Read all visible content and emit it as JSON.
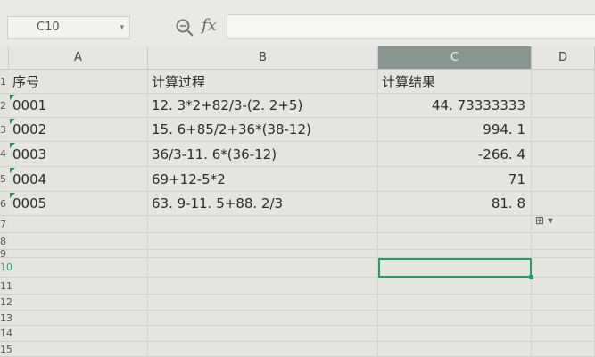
{
  "formula_bar": {
    "name_box": "C10",
    "name_box_caret": "▾",
    "fx_label": "fx",
    "formula_value": ""
  },
  "columns": [
    "A",
    "B",
    "C",
    "D"
  ],
  "rows": [
    "1",
    "2",
    "3",
    "4",
    "5",
    "6",
    "7",
    "8",
    "9",
    "10",
    "11",
    "12",
    "13",
    "14",
    "15"
  ],
  "table": {
    "header": [
      "序号",
      "计算过程",
      "计算结果"
    ],
    "records": [
      {
        "id": "0001",
        "expr": "12. 3*2+82/3-(2. 2+5)",
        "result": "44. 73333333"
      },
      {
        "id": "0002",
        "expr": "15. 6+85/2+36*(38-12)",
        "result": "994. 1"
      },
      {
        "id": "0003",
        "expr": "36/3-11. 6*(36-12)",
        "result": "-266. 4"
      },
      {
        "id": "0004",
        "expr": "69+12-5*2",
        "result": "71"
      },
      {
        "id": "0005",
        "expr": "63. 9-11. 5+88. 2/3",
        "result": "81. 8"
      }
    ]
  },
  "paste_options_label": "⊞ ▾",
  "active_cell": "C10",
  "colors": {
    "selection": "#1f9e6a",
    "active_column_header": "#8a9490"
  }
}
